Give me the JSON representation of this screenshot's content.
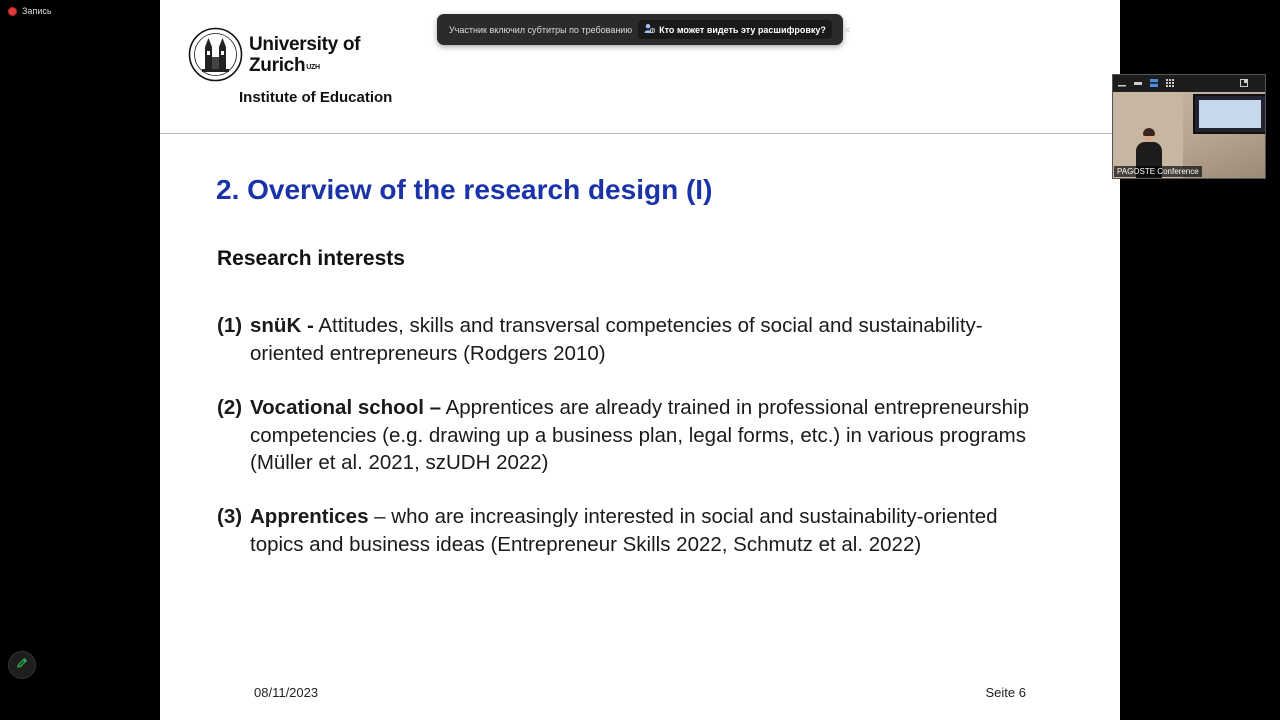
{
  "recording": {
    "label": "Запись",
    "dot_color": "#e23b3b"
  },
  "toast": {
    "message": "Участник включил субтитры по требованию",
    "link_label": "Кто может видеть эту расшифровку?",
    "close_label": "×",
    "icon": "person-question-icon"
  },
  "slide": {
    "logo_line1": "University of",
    "logo_line2": "Zurich",
    "logo_sup": "UZH",
    "institute": "Institute of Education",
    "title": "2. Overview of the research design (I)",
    "section_heading": "Research interests",
    "items": [
      {
        "num": "(1)",
        "term": "snüK -",
        "text": " Attitudes, skills and transversal competencies of social and sustainability-oriented entrepreneurs (Rodgers 2010)"
      },
      {
        "num": "(2)",
        "term": "Vocational school –",
        "text": " Apprentices are already trained in professional entrepreneurship competencies (e.g. drawing up a business plan, legal forms, etc.) in various programs (Müller et al. 2021, szUDH 2022)"
      },
      {
        "num": "(3)",
        "term": "Apprentices",
        "text": " – who are increasingly interested in social and sustainability-oriented topics and business ideas (Entrepreneur Skills 2022, Schmutz et al. 2022)"
      }
    ],
    "footer_date": "08/11/2023",
    "footer_page": "Seite 6",
    "title_color": "#1a33a8"
  },
  "video": {
    "label": "PAGOSTE Conference",
    "toolbar_icons": [
      "minimize-icon",
      "hide-video-icon",
      "speaker-view-icon",
      "gallery-view-icon",
      "pop-out-icon"
    ]
  },
  "annotate": {
    "icon": "pencil-icon",
    "color": "#2fb34a"
  }
}
